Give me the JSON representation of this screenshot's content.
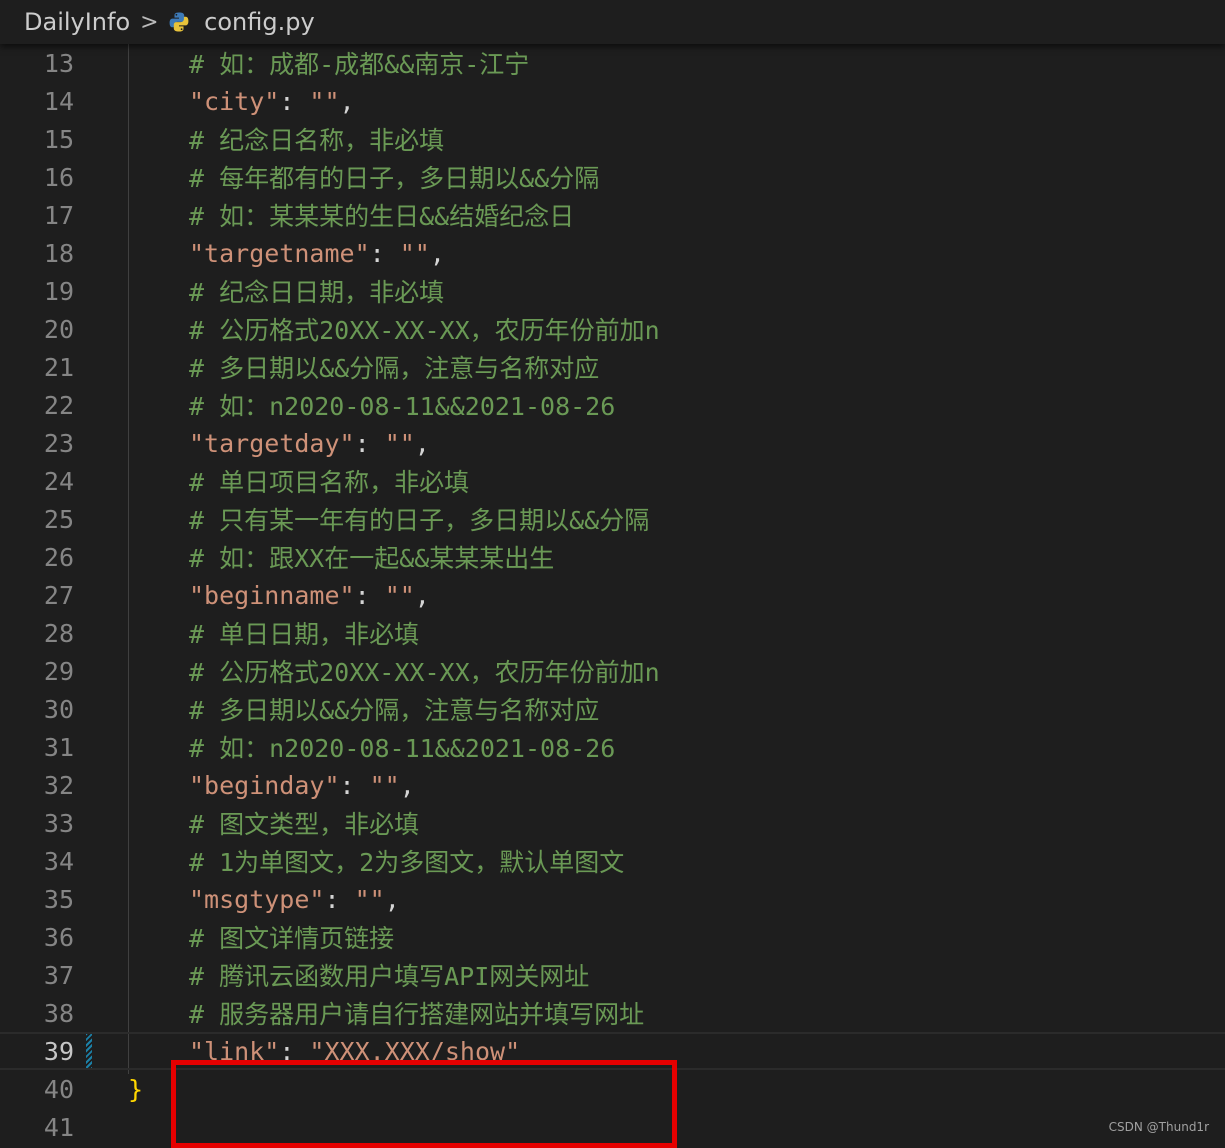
{
  "breadcrumb": {
    "folder": "DailyInfo",
    "separator": ">",
    "file": "config.py",
    "file_icon": "python-icon"
  },
  "editor": {
    "current_line": 39,
    "lines": [
      {
        "n": "13",
        "comment": "# 如：成都-成都&&南京-江宁"
      },
      {
        "n": "14",
        "key": "\"city\"",
        "colon": ": ",
        "value": "\"\"",
        "end": ","
      },
      {
        "n": "15",
        "comment": "# 纪念日名称，非必填"
      },
      {
        "n": "16",
        "comment": "# 每年都有的日子，多日期以&&分隔"
      },
      {
        "n": "17",
        "comment": "# 如：某某某的生日&&结婚纪念日"
      },
      {
        "n": "18",
        "key": "\"targetname\"",
        "colon": ": ",
        "value": "\"\"",
        "end": ","
      },
      {
        "n": "19",
        "comment": "# 纪念日日期，非必填"
      },
      {
        "n": "20",
        "comment": "# 公历格式20XX-XX-XX，农历年份前加n"
      },
      {
        "n": "21",
        "comment": "# 多日期以&&分隔，注意与名称对应"
      },
      {
        "n": "22",
        "comment": "# 如：n2020-08-11&&2021-08-26"
      },
      {
        "n": "23",
        "key": "\"targetday\"",
        "colon": ": ",
        "value": "\"\"",
        "end": ","
      },
      {
        "n": "24",
        "comment": "# 单日项目名称，非必填"
      },
      {
        "n": "25",
        "comment": "# 只有某一年有的日子，多日期以&&分隔"
      },
      {
        "n": "26",
        "comment": "# 如：跟XX在一起&&某某某出生"
      },
      {
        "n": "27",
        "key": "\"beginname\"",
        "colon": ": ",
        "value": "\"\"",
        "end": ","
      },
      {
        "n": "28",
        "comment": "# 单日日期，非必填"
      },
      {
        "n": "29",
        "comment": "# 公历格式20XX-XX-XX，农历年份前加n"
      },
      {
        "n": "30",
        "comment": "# 多日期以&&分隔，注意与名称对应"
      },
      {
        "n": "31",
        "comment": "# 如：n2020-08-11&&2021-08-26"
      },
      {
        "n": "32",
        "key": "\"beginday\"",
        "colon": ": ",
        "value": "\"\"",
        "end": ","
      },
      {
        "n": "33",
        "comment": "# 图文类型，非必填"
      },
      {
        "n": "34",
        "comment": "# 1为单图文，2为多图文，默认单图文"
      },
      {
        "n": "35",
        "key": "\"msgtype\"",
        "colon": ": ",
        "value": "\"\"",
        "end": ","
      },
      {
        "n": "36",
        "comment": "# 图文详情页链接"
      },
      {
        "n": "37",
        "comment": "# 腾讯云函数用户填写API网关网址"
      },
      {
        "n": "38",
        "comment": "# 服务器用户请自行搭建网站并填写网址"
      },
      {
        "n": "39",
        "key": "\"link\"",
        "colon": ": ",
        "value": "\"XXX.XXX/show\"",
        "end": ""
      },
      {
        "n": "40",
        "brace": "}"
      },
      {
        "n": "41"
      }
    ]
  },
  "watermark": "CSDN @Thund1r",
  "colors": {
    "background": "#1e1e1e",
    "comment": "#6a9955",
    "string": "#ce9178",
    "brace": "#ffd700",
    "highlight_box": "#e60000"
  }
}
